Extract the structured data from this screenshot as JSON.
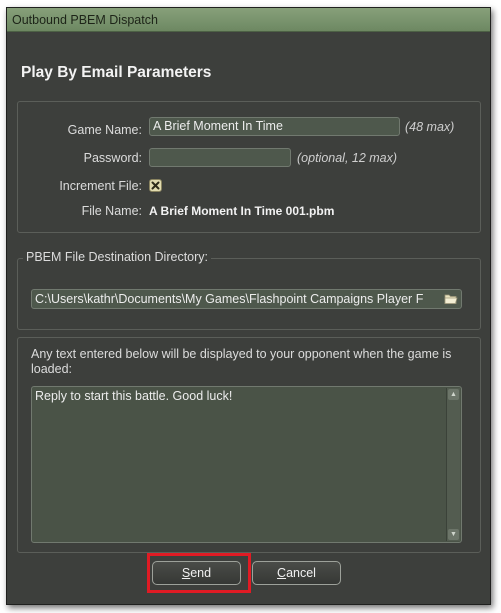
{
  "window": {
    "title": "Outbound PBEM Dispatch"
  },
  "heading": "Play By Email Parameters",
  "params": {
    "game_name_label": "Game Name:",
    "game_name_value": "A Brief Moment In Time",
    "game_name_hint": "(48 max)",
    "password_label": "Password:",
    "password_value": "",
    "password_hint": "(optional, 12 max)",
    "increment_label": "Increment File:",
    "increment_checked": true,
    "file_name_label": "File Name:",
    "file_name_value": "A Brief Moment In Time 001.pbm"
  },
  "destination": {
    "legend": "PBEM File Destination Directory:",
    "path": "C:\\Users\\kathr\\Documents\\My Games\\Flashpoint Campaigns Player F",
    "icon": "folder-icon"
  },
  "message": {
    "note": "Any text entered below will be displayed to your opponent when the game is loaded:",
    "text": "Reply to start this battle. Good luck!"
  },
  "buttons": {
    "send_label": "Send",
    "send_mnemonic": "S",
    "cancel_label": "Cancel",
    "cancel_mnemonic": "C"
  },
  "colors": {
    "titlebar": "#7a9570",
    "dialog_bg": "#3d3f3c",
    "field_bg": "#4e584c",
    "highlight": "#e01b24"
  }
}
